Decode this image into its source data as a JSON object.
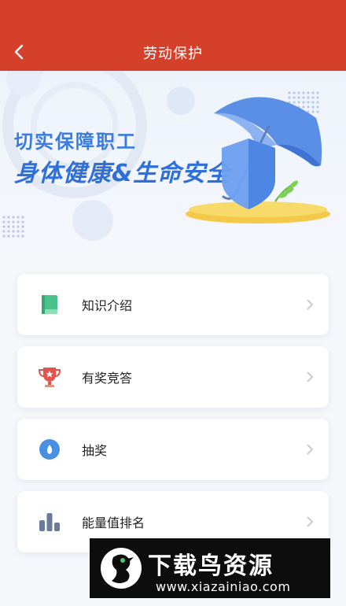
{
  "header": {
    "title": "劳动保护"
  },
  "banner": {
    "line1": "切实保障职工",
    "line2": "身体健康&生命安全"
  },
  "menu": [
    {
      "label": "知识介绍",
      "icon": "book-icon",
      "color": "#49c18b"
    },
    {
      "label": "有奖竞答",
      "icon": "trophy-icon",
      "color": "#e5534b"
    },
    {
      "label": "抽奖",
      "icon": "lottery-icon",
      "color": "#4a90e2"
    },
    {
      "label": "能量值排名",
      "icon": "ranking-bars-icon",
      "color": "#6b7a99"
    }
  ],
  "watermark": {
    "title": "下载鸟资源",
    "url": "www.xiazainiao.com"
  },
  "colors": {
    "header": "#d5402b",
    "accent": "#2f6fd8",
    "background": "#f5f7fb"
  }
}
